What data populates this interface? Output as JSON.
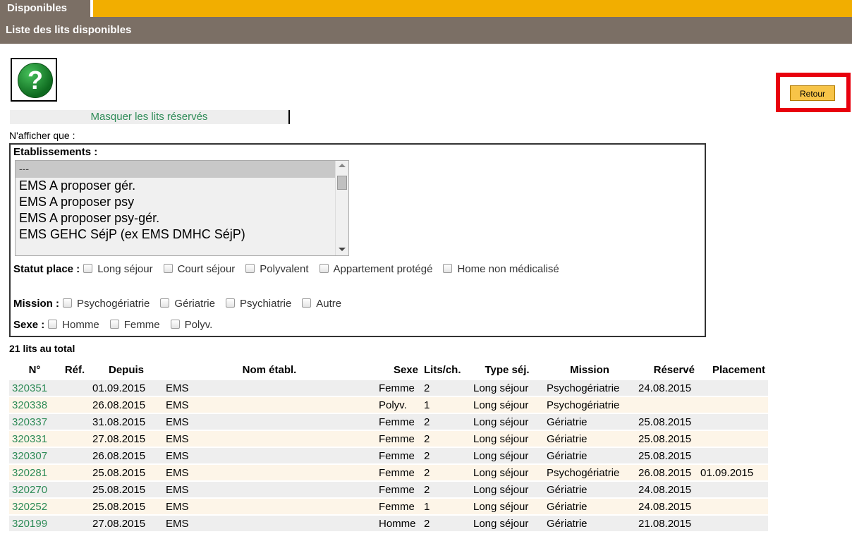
{
  "tab": {
    "label": "Disponibles"
  },
  "header": {
    "title": "Liste des lits disponibles"
  },
  "help_button": {
    "glyph": "?"
  },
  "retour_button": {
    "label": "Retour"
  },
  "masquer_link": {
    "label": "Masquer les lits réservés"
  },
  "filter": {
    "intro": "N'afficher que :",
    "etablissements_label": "Etablissements :",
    "etablissements_options": [
      "---",
      "EMS A proposer gér.",
      "EMS A proposer psy",
      "EMS A proposer psy-gér.",
      "EMS GEHC SéjP (ex EMS DMHC SéjP)"
    ],
    "statut_label": "Statut place :",
    "statut_options": [
      "Long séjour",
      "Court séjour",
      "Polyvalent",
      "Appartement protégé",
      "Home non médicalisé"
    ],
    "mission_label": "Mission :",
    "mission_options": [
      "Psychogériatrie",
      "Gériatrie",
      "Psychiatrie",
      "Autre"
    ],
    "sexe_label": "Sexe :",
    "sexe_options": [
      "Homme",
      "Femme",
      "Polyv."
    ]
  },
  "total": "21 lits au total",
  "table": {
    "headers": [
      "N°",
      "Réf.",
      "Depuis",
      "Nom établ.",
      "Sexe",
      "Lits/ch.",
      "Type séj.",
      "Mission",
      "Réservé",
      "Placement"
    ],
    "rows": [
      [
        "320351",
        "",
        "01.09.2015",
        "EMS",
        "Femme",
        "2",
        "Long séjour",
        "Psychogériatrie",
        "24.08.2015",
        ""
      ],
      [
        "320338",
        "",
        "26.08.2015",
        "EMS",
        "Polyv.",
        "1",
        "Long séjour",
        "Psychogériatrie",
        "",
        ""
      ],
      [
        "320337",
        "",
        "31.08.2015",
        "EMS",
        "Femme",
        "2",
        "Long séjour",
        "Gériatrie",
        "25.08.2015",
        ""
      ],
      [
        "320331",
        "",
        "27.08.2015",
        "EMS",
        "Femme",
        "2",
        "Long séjour",
        "Gériatrie",
        "25.08.2015",
        ""
      ],
      [
        "320307",
        "",
        "26.08.2015",
        "EMS",
        "Femme",
        "2",
        "Long séjour",
        "Gériatrie",
        "25.08.2015",
        ""
      ],
      [
        "320281",
        "",
        "25.08.2015",
        "EMS",
        "Femme",
        "2",
        "Long séjour",
        "Psychogériatrie",
        "26.08.2015",
        "01.09.2015"
      ],
      [
        "320270",
        "",
        "25.08.2015",
        "EMS",
        "Femme",
        "2",
        "Long séjour",
        "Gériatrie",
        "24.08.2015",
        ""
      ],
      [
        "320252",
        "",
        "25.08.2015",
        "EMS",
        "Femme",
        "1",
        "Long séjour",
        "Gériatrie",
        "24.08.2015",
        ""
      ],
      [
        "320199",
        "",
        "27.08.2015",
        "EMS",
        "Homme",
        "2",
        "Long séjour",
        "Gériatrie",
        "21.08.2015",
        ""
      ]
    ]
  }
}
